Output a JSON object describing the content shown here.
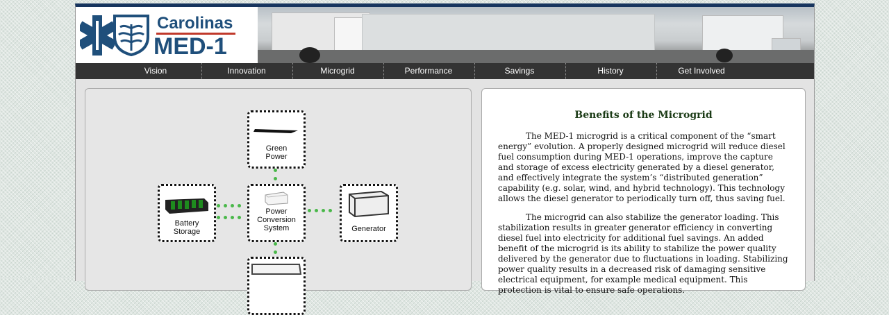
{
  "header": {
    "logo_line1": "Carolinas",
    "logo_line2": "MED-1"
  },
  "nav": {
    "items": [
      "Vision",
      "Innovation",
      "Microgrid",
      "Performance",
      "Savings",
      "History",
      "Get Involved"
    ]
  },
  "diagram": {
    "green_power": "Green Power",
    "power_conversion": "Power Conversion System",
    "battery_storage": "Battery Storage",
    "generator": "Generator",
    "dot_color": "#4ab84a"
  },
  "article": {
    "title": "Benefits of the Microgrid",
    "paragraph1": "The MED-1 microgrid is a critical component of the “smart energy” evolution. A properly designed microgrid will reduce diesel fuel consumption during MED-1 operations, improve the capture and storage of excess electricity generated by a diesel generator, and effectively integrate the system’s “distributed generation” capability (e.g. solar, wind, and hybrid technology). This technology allows the diesel generator to periodically turn off, thus saving fuel.",
    "paragraph2": "The microgrid can also stabilize the generator loading. This stabilization results in greater generator efficiency in converting diesel fuel into electricity for additional fuel savings. An added benefit of the microgrid is its ability to stabilize the power quality delivered by the generator due to fluctuations in loading. Stabilizing power quality results in a decreased risk of damaging sensitive electrical equipment, for example medical equipment. This protection is vital to ensure safe operations."
  },
  "colors": {
    "nav_bg": "#333333",
    "brand_blue": "#1f4f7b",
    "title_green": "#1b3b16"
  }
}
